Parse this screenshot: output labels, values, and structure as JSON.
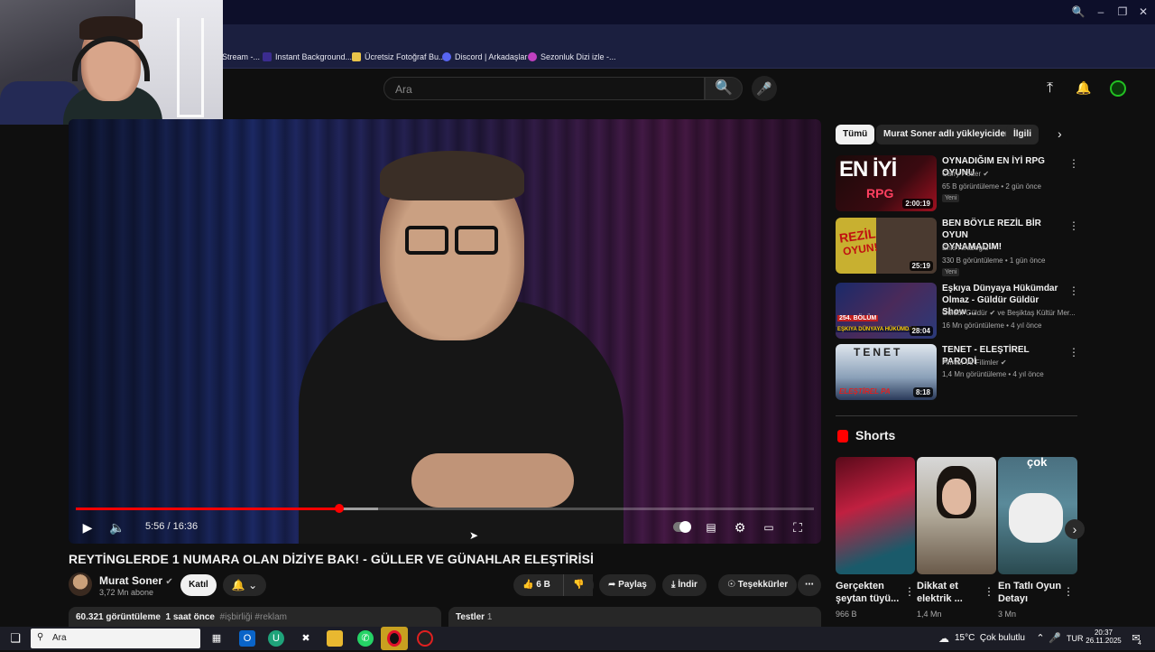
{
  "bookmarks": [
    {
      "label": "Stream -..."
    },
    {
      "label": "Instant Background..."
    },
    {
      "label": "Ücretsiz Fotoğraf Bu..."
    },
    {
      "label": "Discord | Arkadaşlar"
    },
    {
      "label": "Sezonluk Dizi izle -..."
    }
  ],
  "header": {
    "search_placeholder": "Ara"
  },
  "player": {
    "time": "5:56 / 16:36",
    "progress": 0.357,
    "buffered": 0.41
  },
  "video": {
    "title": "REYTİNGLERDE 1 NUMARA OLAN DİZİYE BAK! - GÜLLER VE GÜNAHLAR ELEŞTİRİSİ",
    "channel": "Murat Soner",
    "subscribers": "3,72 Mn abone",
    "join_label": "Katıl",
    "likes": "6 B",
    "share_label": "Paylaş",
    "download_label": "İndir",
    "thanks_label": "Teşekkürler",
    "views": "60.321 görüntüleme",
    "age": "1 saat önce",
    "tags": "#işbirliği #reklam",
    "tests_label": "Testler",
    "tests_count": "1"
  },
  "chips": [
    "Tümü",
    "Murat Soner adlı yükleyiciden",
    "İlgili"
  ],
  "recommendations": [
    {
      "title": "OYNADIĞIM EN İYİ RPG OYUNU",
      "title2": "",
      "channel": "Carry Potter",
      "meta": "65 B görüntüleme • 2 gün önce",
      "badge": "Yeni",
      "duration": "2:00:19",
      "thumb_text": "EN İYİ",
      "thumb_sub": "RPG"
    },
    {
      "title": "BEN BÖYLE REZİL BİR OYUN",
      "title2": "OYNAMADIM!",
      "channel": "Enis Kirazoglu",
      "meta": "330 B görüntüleme • 1 gün önce",
      "badge": "Yeni",
      "duration": "25:19",
      "thumb_text": "REZİL",
      "thumb_sub": "OYUN!"
    },
    {
      "title": "Eşkıya Dünyaya Hükümdar",
      "title2": "Olmaz - Güldür Güldür Show ...",
      "channel": "Güldür Güldür",
      "channel_extra": "ve Beşiktaş Kültür Mer...",
      "meta": "16 Mn görüntüleme • 4 yıl önce",
      "badge": "",
      "duration": "28:04",
      "thumb_text": "254. BÖLÜM",
      "thumb_sub": "EŞKIYA DÜNYAYA HÜKÜMDAR"
    },
    {
      "title": "TENET - ELEŞTİREL PARODİ",
      "title2": "",
      "channel": "Filmler ve Filimler",
      "meta": "1,4 Mn görüntüleme • 4 yıl önce",
      "badge": "",
      "duration": "8:18",
      "thumb_text": "TENET",
      "thumb_sub": "ELEŞTİREL PA"
    }
  ],
  "shorts": {
    "heading": "Shorts",
    "items": [
      {
        "title": "Gerçekten",
        "title2": "şeytan tüyü...",
        "views": "966 B",
        "thumb_text": ""
      },
      {
        "title": "Dikkat et",
        "title2": "elektrik ...",
        "views": "1,4 Mn",
        "thumb_text": ""
      },
      {
        "title": "En Tatlı Oyun",
        "title2": "Detayı",
        "views": "3 Mn",
        "thumb_text": "çok"
      }
    ]
  },
  "taskbar": {
    "search_placeholder": "Ara",
    "temperature": "15°C",
    "weather": "Çok bulutlu",
    "language": "TUR",
    "time": "20:37",
    "date": "26.11.2025",
    "notifications": "4"
  },
  "colors": {
    "accent_red": "#ff0000",
    "bg": "#0f0f0f",
    "chip": "#272727"
  }
}
